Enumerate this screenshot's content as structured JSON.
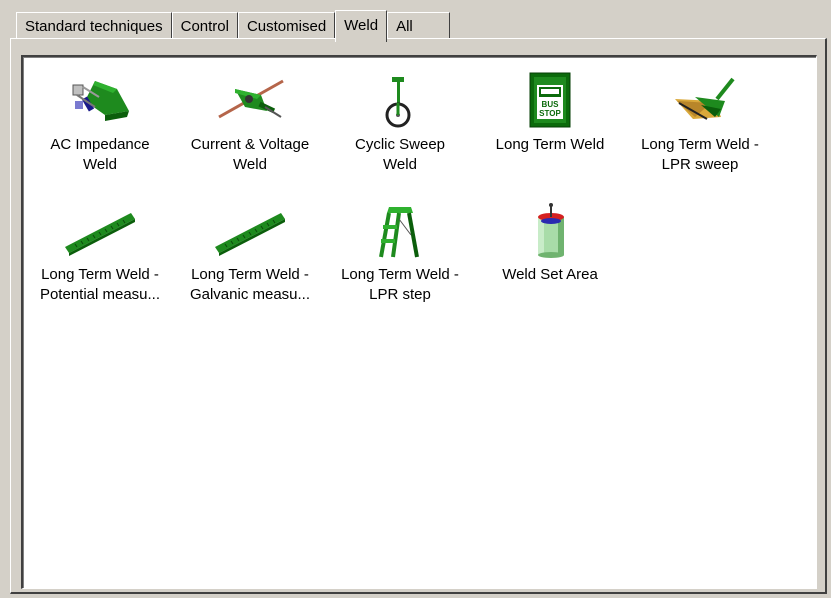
{
  "tabs": [
    {
      "label": "Standard techniques",
      "active": false
    },
    {
      "label": "Control",
      "active": false
    },
    {
      "label": "Customised",
      "active": false
    },
    {
      "label": "Weld",
      "active": true
    },
    {
      "label": "All",
      "active": false
    }
  ],
  "items": [
    {
      "line1": "AC Impedance",
      "line2": "Weld",
      "icon": "ac-impedance-icon"
    },
    {
      "line1": "Current & Voltage",
      "line2": "Weld",
      "icon": "current-voltage-icon"
    },
    {
      "line1": "Cyclic Sweep",
      "line2": "Weld",
      "icon": "unicycle-icon"
    },
    {
      "line1": "Long Term Weld",
      "line2": "",
      "icon": "bus-stop-icon"
    },
    {
      "line1": "Long Term Weld -",
      "line2": "LPR sweep",
      "icon": "dustpan-icon"
    },
    {
      "line1": "Long Term Weld -",
      "line2": "Potential measu...",
      "icon": "ruler-icon"
    },
    {
      "line1": "Long Term Weld -",
      "line2": "Galvanic measu...",
      "icon": "ruler-icon"
    },
    {
      "line1": "Long Term Weld -",
      "line2": "LPR step",
      "icon": "stepladder-icon"
    },
    {
      "line1": "Weld Set Area",
      "line2": "",
      "icon": "weld-set-area-icon"
    }
  ],
  "bus_stop_sign": {
    "line1": "BUS",
    "line2": "STOP"
  },
  "colors": {
    "face": "#d4d0c8",
    "icon_green": "#1e8a1e",
    "icon_dark_green": "#0b5e0b"
  }
}
